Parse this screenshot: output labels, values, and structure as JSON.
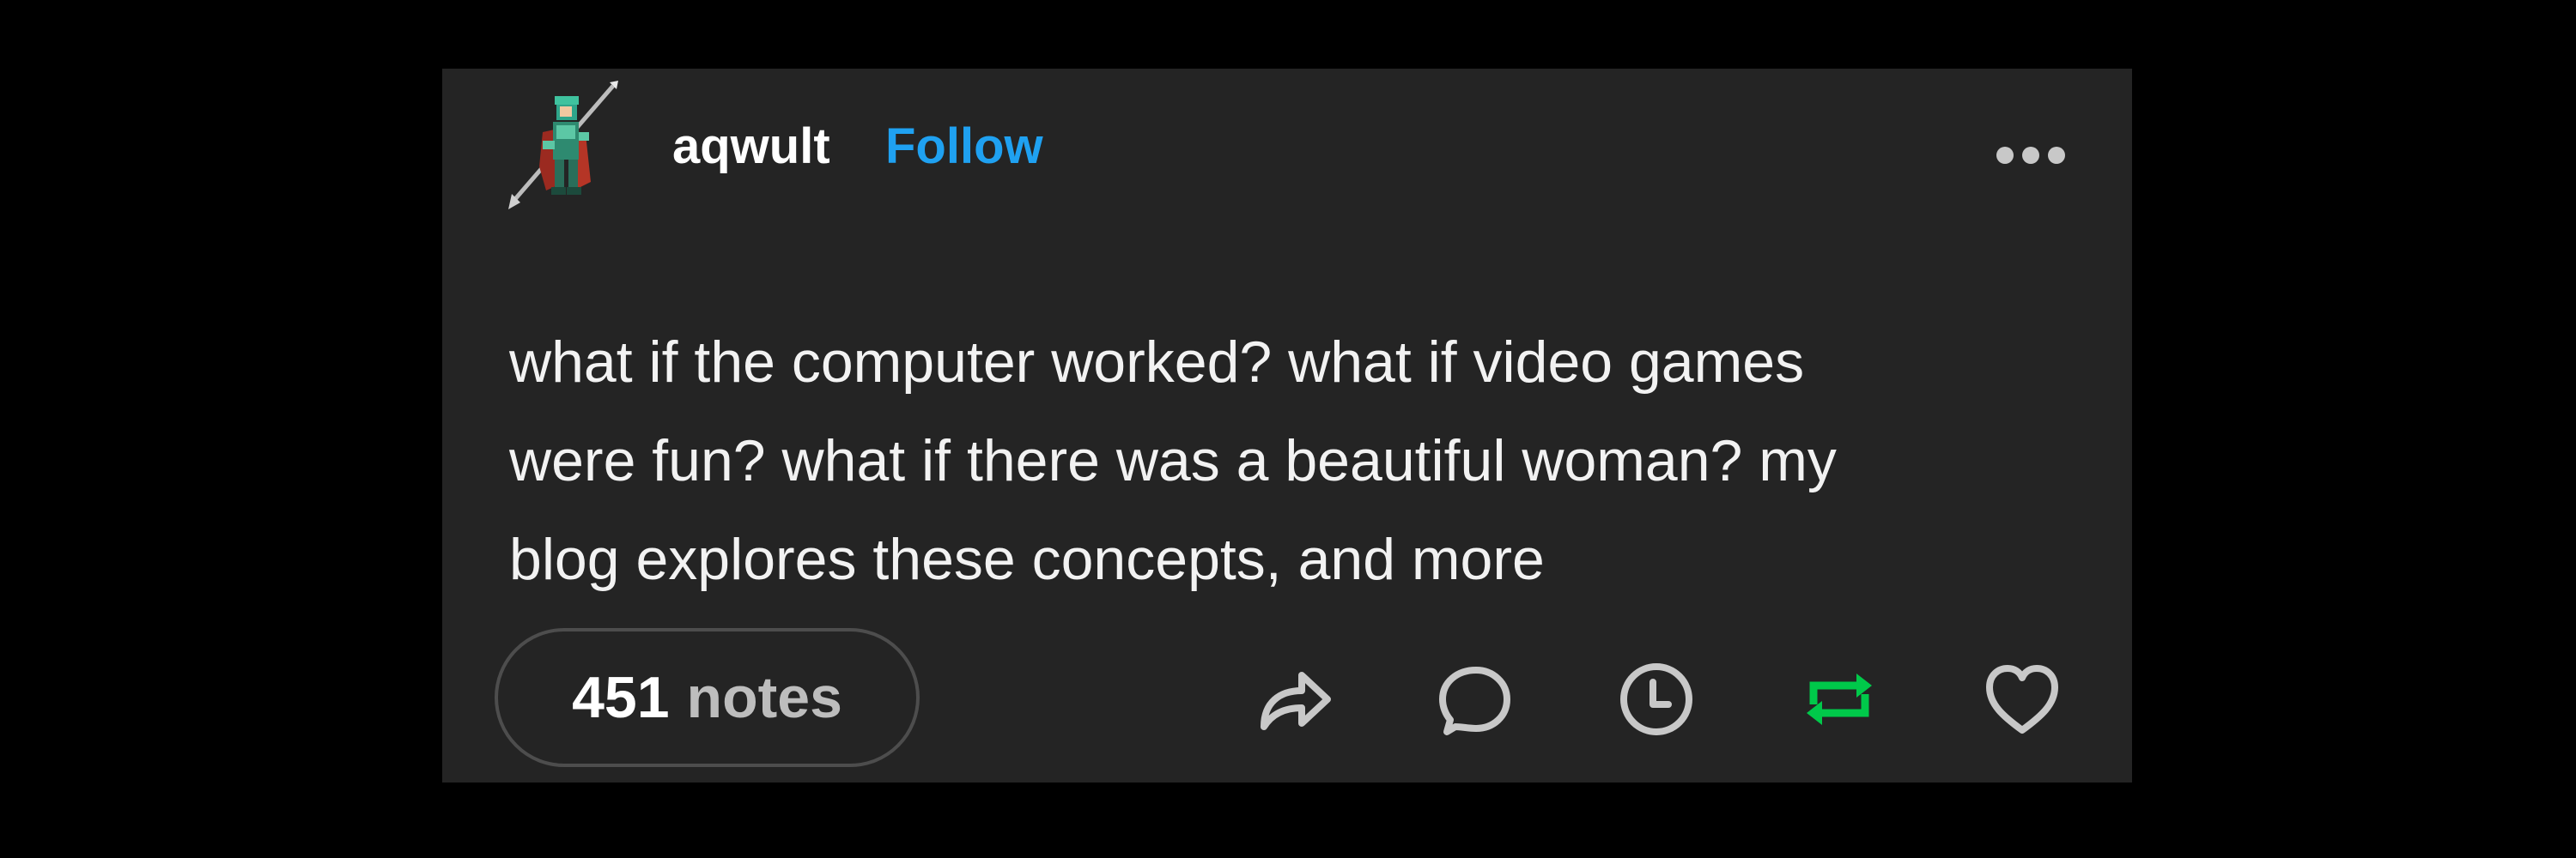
{
  "post": {
    "username": "aqwult",
    "follow_label": "Follow",
    "body_lines": [
      "what if the computer worked? what if video games",
      "were fun? what if there was a beautiful woman? my",
      "blog explores these concepts, and more"
    ],
    "notes_count": "451",
    "notes_label": "notes"
  },
  "icons": {
    "avatar": "pixel-knight-avatar",
    "more": "more-dots-icon",
    "share": "share-arrow-icon",
    "reply": "speech-bubble-icon",
    "queue": "clock-icon",
    "reblog": "reblog-icon",
    "like": "heart-icon"
  },
  "colors": {
    "page_background": "#000000",
    "card_background": "#242424",
    "follow": "#1fa1f1",
    "reblog_active": "#00c94a",
    "icon_default": "#c8c8c8"
  }
}
